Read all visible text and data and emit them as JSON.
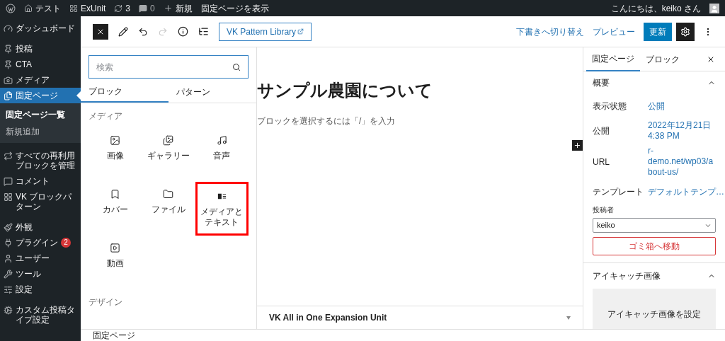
{
  "admin_bar": {
    "site": "テスト",
    "plugin": "ExUnit",
    "updates": "3",
    "comments": "0",
    "new": "新規",
    "view": "固定ページを表示",
    "greeting": "こんにちは、keiko さん"
  },
  "sidebar": {
    "items": [
      {
        "label": "ダッシュボード",
        "selected": false
      },
      {
        "label": "投稿",
        "selected": false
      },
      {
        "label": "CTA",
        "selected": false
      },
      {
        "label": "メディア",
        "selected": false
      },
      {
        "label": "固定ページ",
        "selected": true,
        "children": [
          {
            "label": "固定ページ一覧",
            "selected": true
          },
          {
            "label": "新規追加",
            "selected": false
          }
        ]
      },
      {
        "label": "すべての再利用ブロックを管理",
        "selected": false
      },
      {
        "label": "コメント",
        "selected": false
      },
      {
        "label": "VK ブロックパターン",
        "selected": false
      },
      {
        "label": "外観",
        "selected": false
      },
      {
        "label": "プラグイン",
        "selected": false,
        "badge": "2"
      },
      {
        "label": "ユーザー",
        "selected": false
      },
      {
        "label": "ツール",
        "selected": false
      },
      {
        "label": "設定",
        "selected": false
      },
      {
        "label": "カスタム投稿タイプ設定",
        "selected": false
      }
    ]
  },
  "toolbar": {
    "pattern_library": "VK Pattern Library",
    "switch_draft": "下書きへ切り替え",
    "preview": "プレビュー",
    "update": "更新"
  },
  "inserter": {
    "search": {
      "placeholder": "検索"
    },
    "tabs": [
      {
        "label": "ブロック",
        "selected": true
      },
      {
        "label": "パターン",
        "selected": false
      }
    ],
    "categories": [
      {
        "title": "メディア",
        "blocks": [
          {
            "label": "画像",
            "highlighted": false
          },
          {
            "label": "ギャラリー",
            "highlighted": false
          },
          {
            "label": "音声",
            "highlighted": false
          },
          {
            "label": "カバー",
            "highlighted": false
          },
          {
            "label": "ファイル",
            "highlighted": false
          },
          {
            "label": "メディアとテキスト",
            "highlighted": true
          },
          {
            "label": "動画",
            "highlighted": false
          }
        ]
      },
      {
        "title": "デザイン"
      }
    ]
  },
  "canvas": {
    "title": "サンプル農園について",
    "hint": "ブロックを選択するには「/」を入力",
    "meta_box": "VK All in One Expansion Unit"
  },
  "settings": {
    "tabs": [
      {
        "label": "固定ページ",
        "selected": true
      },
      {
        "label": "ブロック",
        "selected": false
      }
    ],
    "summary": {
      "title": "概要",
      "expanded": true,
      "rows": [
        {
          "label": "表示状態",
          "value": "公開"
        },
        {
          "label": "公開",
          "value": "2022年12月21日 4:38 PM"
        },
        {
          "label": "URL",
          "value": "r-demo.net/wp03/about-us/"
        },
        {
          "label": "テンプレート",
          "value": "デフォルトテンプ…"
        }
      ],
      "author_label": "投稿者",
      "author": "keiko",
      "trash": "ゴミ箱へ移動"
    },
    "featured": {
      "title": "アイキャッチ画像",
      "expanded": true,
      "button": "アイキャッチ画像を設定"
    }
  },
  "footer": {
    "breadcrumb": "固定ページ"
  }
}
